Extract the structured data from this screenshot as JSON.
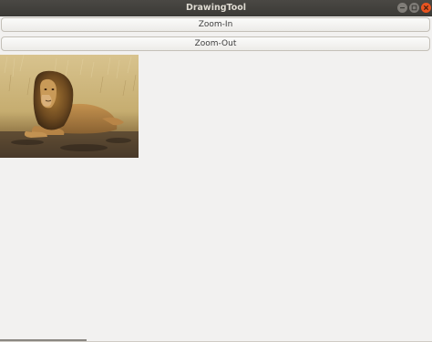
{
  "window": {
    "title": "DrawingTool",
    "controls": {
      "minimize_icon": "minimize-icon",
      "maximize_icon": "maximize-icon",
      "close_icon": "close-icon",
      "close_color": "#e95420"
    }
  },
  "toolbar": {
    "zoom_in_label": "Zoom-In",
    "zoom_out_label": "Zoom-Out"
  },
  "canvas": {
    "image_subject": "lion"
  }
}
